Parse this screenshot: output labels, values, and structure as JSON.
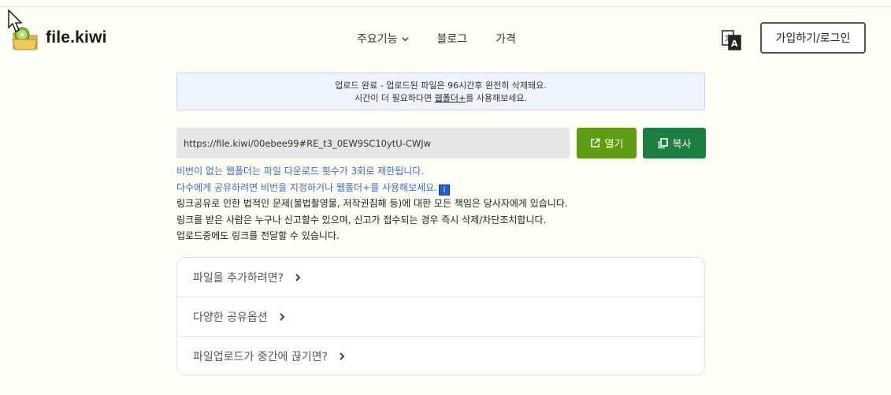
{
  "header": {
    "logo_text": "file.kiwi",
    "nav": [
      {
        "label": "주요기능",
        "has_dropdown": true
      },
      {
        "label": "블로그",
        "has_dropdown": false
      },
      {
        "label": "가격",
        "has_dropdown": false
      }
    ],
    "language_icon": "translate-icon",
    "login_label": "가입하기/로그인"
  },
  "notice": {
    "line1": "업로드 완료 - 업로드된 파일은 96시간후 완전히 삭제돼요.",
    "line2_prefix": "시간이 더 필요하다면 ",
    "line2_link": "웹폴더+",
    "line2_suffix": "를 사용해보세요."
  },
  "share": {
    "url": "https://file.kiwi/00ebee99#RE_t3_0EW9SC10ytU-CWJw",
    "open_label": "열기",
    "copy_label": "복사"
  },
  "info": {
    "blue_line1": "비번이 없는 웹폴더는 파일 다운로드 횟수가 3회로 제한됩니다.",
    "blue_line2": "다수에게 공유하려면 비번을 지정하거나 웹폴더+를 사용해보세요.",
    "badge": "i",
    "line3": "링크공유로 인한 법적인 문제(불법촬영물, 저작권침해 등)에 대한 모든 책임은 당사자에게 있습니다.",
    "line4": "링크를 받은 사람은 누구나 신고할수 있으며, 신고가 접수되는 경우 즉시 삭제/차단조치합니다.",
    "line5": "업로드중에도 링크를 전달할 수 있습니다."
  },
  "accordion": [
    {
      "label": "파일을 추가하려면?"
    },
    {
      "label": "다양한 공유옵션"
    },
    {
      "label": "파일업로드가 중간에 끊기면?"
    }
  ],
  "colors": {
    "background": "#fefef4",
    "open_button": "#5e9d11",
    "copy_button": "#1a7f3f",
    "notice_bg": "#eef4fd",
    "info_blue": "#3a6fd0"
  }
}
